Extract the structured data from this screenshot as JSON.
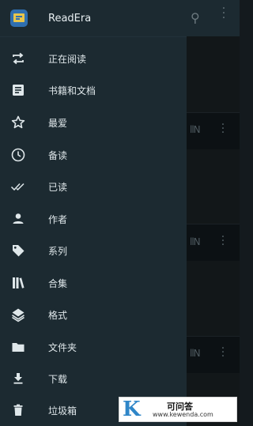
{
  "app": {
    "title": "ReadEra"
  },
  "menu": {
    "items": [
      {
        "label": "正在阅读",
        "icon": "repeat-icon"
      },
      {
        "label": "书籍和文档",
        "icon": "document-icon"
      },
      {
        "label": "最爱",
        "icon": "star-icon"
      },
      {
        "label": "备读",
        "icon": "clock-icon"
      },
      {
        "label": "已读",
        "icon": "double-check-icon"
      },
      {
        "label": "作者",
        "icon": "person-icon"
      },
      {
        "label": "系列",
        "icon": "tag-icon"
      },
      {
        "label": "合集",
        "icon": "books-icon"
      },
      {
        "label": "格式",
        "icon": "layers-icon"
      },
      {
        "label": "文件夹",
        "icon": "folder-icon"
      },
      {
        "label": "下载",
        "icon": "download-icon"
      },
      {
        "label": "垃圾箱",
        "icon": "trash-icon"
      }
    ]
  },
  "watermark": {
    "logo_text": "K",
    "title": "可问答",
    "url": "www.kewenda.com"
  },
  "colors": {
    "drawer_bg": "#1c2a31",
    "icon": "#dfe7ea",
    "logo_blue": "#2f6fb0",
    "logo_yellow": "#e7c54b"
  }
}
